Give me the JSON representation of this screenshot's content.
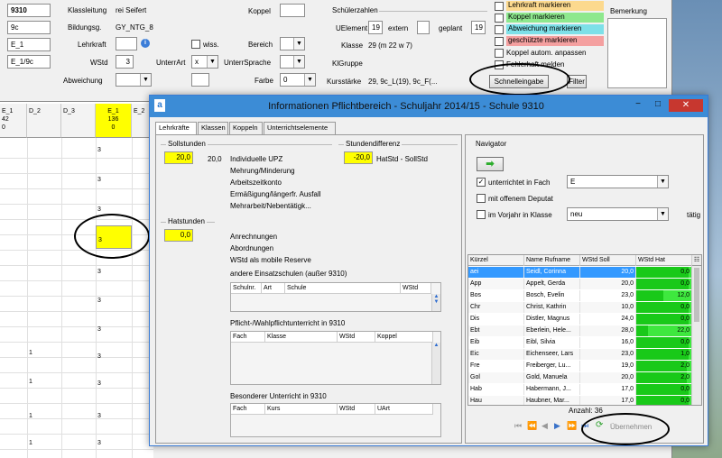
{
  "top_form": {
    "school_no": "9310",
    "klassenleitung_label": "Klassleitung",
    "klassenleitung_value": "rei Seifert",
    "koppel_label": "Koppel",
    "class_name": "9c",
    "bildungsg_label": "Bildungsg.",
    "bildungsg_value": "GY_NTG_8",
    "e1": "E_1",
    "lehrkraft_label": "Lehrkraft",
    "wiss_label": "wiss.",
    "bereich_label": "Bereich",
    "e19c": "E_1/9c",
    "wstd_label": "WStd",
    "wstd_value": "3",
    "unterrart_label": "UnterrArt",
    "unterrart_value": "x",
    "unterrsprache_label": "UnterrSprache",
    "abweichung_label": "Abweichung",
    "farbe_label": "Farbe",
    "farbe_value": "0",
    "schuelerzahlen_label": "Schülerzahlen",
    "uelement_label": "UElement",
    "uelement_value": "19",
    "extern_label": "extern",
    "geplant_label": "geplant",
    "geplant_value": "19",
    "klasse_label": "Klasse",
    "klasse_value": "29 (m 22 w 7)",
    "klgruppe_label": "KlGruppe",
    "kursstaerke_label": "Kursstärke",
    "kursstaerke_value": "29, 9c_L(19), 9c_F(..."
  },
  "marks": {
    "lehrkraft": "Lehrkraft markieren",
    "koppel": "Koppel markieren",
    "abweichung": "Abweichung markieren",
    "geschuetzte": "geschützte markieren",
    "koppel_autom": "Koppel autom. anpassen",
    "fehler": "Fehlerhaft melden",
    "schnelleingabe": "Schnelleingabe",
    "filter": "Filter",
    "bemerkung": "Bemerkung"
  },
  "grid": {
    "headers": [
      {
        "l1": "E_1",
        "l2": "42",
        "l3": "0"
      },
      {
        "l1": "D_2",
        "l2": "",
        "l3": ""
      },
      {
        "l1": "D_3",
        "l2": "",
        "l3": ""
      },
      {
        "l1": "E_1",
        "l2": "136",
        "l3": "0"
      },
      {
        "l1": "E_2",
        "l2": "",
        "l3": ""
      }
    ],
    "col4_values": [
      "3",
      "3",
      "3",
      "3",
      "3",
      "3",
      "3",
      "3",
      "3",
      "3",
      "3",
      "3"
    ],
    "col1_values": [
      "1",
      "1",
      "1",
      "1",
      "1",
      "1"
    ],
    "highlighted": "3"
  },
  "dialog": {
    "title": "Informationen Pflichtbereich - Schuljahr 2014/15 - Schule 9310",
    "tabs": [
      "Lehrkräfte",
      "Klassen",
      "Koppeln",
      "Unterrichtselemente"
    ],
    "sollstunden_label": "Sollstunden",
    "soll_value": "20,0",
    "soll_value2": "20,0",
    "soll_items": [
      "Individuelle UPZ",
      "Mehrung/Minderung",
      "Arbeitszeitkonto",
      "Ermäßigung/längerfr. Ausfall",
      "Mehrarbeit/Nebentätigk..."
    ],
    "stundendiff_label": "Stundendifferenz",
    "diff_value": "-20,0",
    "diff_text": "HatStd - SollStd",
    "hatstunden_label": "Hatstunden",
    "hat_value": "0,0",
    "hat_items": [
      "Anrechnungen",
      "Abordnungen",
      "WStd als mobile Reserve",
      "andere Einsatzschulen (außer 9310)"
    ],
    "t1_headers": [
      "Schulnr.",
      "Art",
      "Schule",
      "WStd"
    ],
    "pflicht_label": "Pflicht-/Wahlpflichtunterricht in 9310",
    "t2_headers": [
      "Fach",
      "Klasse",
      "WStd",
      "Koppel"
    ],
    "besonderer_label": "Besonderer Unterricht in 9310",
    "t3_headers": [
      "Fach",
      "Kurs",
      "WStd",
      "UArt"
    ],
    "navigator_label": "Navigator",
    "unterrichtet_label": "unterrichtet in Fach",
    "unterrichtet_value": "E",
    "deputat_label": "mit offenem Deputat",
    "vorjahr_label": "im Vorjahr in Klasse",
    "vorjahr_value": "neu",
    "taetig_label": "tätig",
    "list_headers": [
      "Kürzel",
      "Name Rufname",
      "WStd Soll",
      "WStd Hat"
    ],
    "rows": [
      {
        "k": "aei",
        "n": "Seidl, Corinna",
        "s": "20,0",
        "h": "0,0",
        "hatfill": 0.0
      },
      {
        "k": "App",
        "n": "Appelt, Gerda",
        "s": "20,0",
        "h": "0,0",
        "hatfill": 0.0
      },
      {
        "k": "Bos",
        "n": "Bosch, Evelin",
        "s": "23,0",
        "h": "12,0",
        "hatfill": 0.52
      },
      {
        "k": "Chr",
        "n": "Christ, Kathrin",
        "s": "10,0",
        "h": "0,0",
        "hatfill": 0.0
      },
      {
        "k": "Dis",
        "n": "Distler, Magnus",
        "s": "24,0",
        "h": "0,0",
        "hatfill": 0.0
      },
      {
        "k": "Ebt",
        "n": "Eberlein, Hele...",
        "s": "28,0",
        "h": "22,0",
        "hatfill": 0.79
      },
      {
        "k": "Eib",
        "n": "Eibl, Silvia",
        "s": "16,0",
        "h": "0,0",
        "hatfill": 0.0
      },
      {
        "k": "Eic",
        "n": "Eichenseer, Lars",
        "s": "23,0",
        "h": "1,0",
        "hatfill": 0.04
      },
      {
        "k": "Fre",
        "n": "Freiberger, Lu...",
        "s": "19,0",
        "h": "2,0",
        "hatfill": 0.1
      },
      {
        "k": "Gol",
        "n": "Gold, Manuela",
        "s": "20,0",
        "h": "2,0",
        "hatfill": 0.1
      },
      {
        "k": "Hab",
        "n": "Habermann, J...",
        "s": "17,0",
        "h": "0,0",
        "hatfill": 0.0
      },
      {
        "k": "Hau",
        "n": "Haubner, Mar...",
        "s": "17,0",
        "h": "0,0",
        "hatfill": 0.0
      }
    ],
    "anzahl": "Anzahl: 36",
    "uebernehmen": "Übernehmen"
  }
}
